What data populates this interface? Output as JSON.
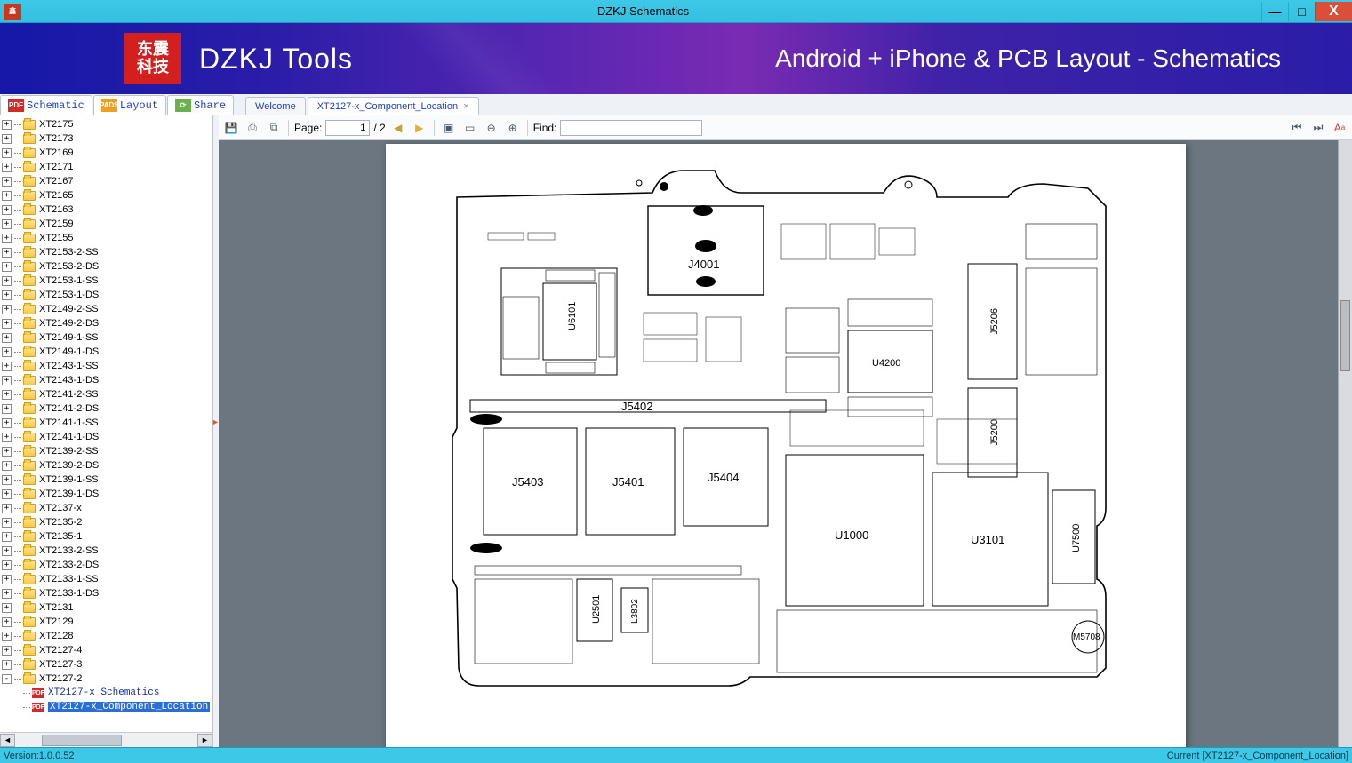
{
  "window": {
    "title": "DZKJ Schematics"
  },
  "banner": {
    "logo_line1": "东震",
    "logo_line2": "科技",
    "tools": "DZKJ Tools",
    "tagline": "Android + iPhone & PCB Layout - Schematics"
  },
  "globalTabs": {
    "schematic": "Schematic",
    "layout": "Layout",
    "share": "Share"
  },
  "docTabs": {
    "welcome": "Welcome",
    "active": "XT2127-x_Component_Location"
  },
  "toolbar": {
    "page_label": "Page:",
    "page_current": "1",
    "page_total": "/ 2",
    "find_label": "Find:",
    "find_value": ""
  },
  "tree": {
    "folders": [
      "XT2175",
      "XT2173",
      "XT2169",
      "XT2171",
      "XT2167",
      "XT2165",
      "XT2163",
      "XT2159",
      "XT2155",
      "XT2153-2-SS",
      "XT2153-2-DS",
      "XT2153-1-SS",
      "XT2153-1-DS",
      "XT2149-2-SS",
      "XT2149-2-DS",
      "XT2149-1-SS",
      "XT2149-1-DS",
      "XT2143-1-SS",
      "XT2143-1-DS",
      "XT2141-2-SS",
      "XT2141-2-DS",
      "XT2141-1-SS",
      "XT2141-1-DS",
      "XT2139-2-SS",
      "XT2139-2-DS",
      "XT2139-1-SS",
      "XT2139-1-DS",
      "XT2137-x",
      "XT2135-2",
      "XT2135-1",
      "XT2133-2-SS",
      "XT2133-2-DS",
      "XT2133-1-SS",
      "XT2133-1-DS",
      "XT2131",
      "XT2129",
      "XT2128",
      "XT2127-4",
      "XT2127-3"
    ],
    "expanded": "XT2127-2",
    "children": [
      "XT2127-x_Schematics",
      "XT2127-x_Component_Location"
    ],
    "selectedChild": 1
  },
  "pcb": {
    "J4001": "J4001",
    "U6101": "U6101",
    "J5402": "J5402",
    "J5403": "J5403",
    "J5401": "J5401",
    "J5404": "J5404",
    "U4200": "U4200",
    "U1000": "U1000",
    "U3101": "U3101",
    "U2501": "U2501",
    "U7500": "U7500",
    "J5206": "J5206",
    "J5200": "J5200",
    "M5708": "M5708",
    "L3802": "L3802"
  },
  "status": {
    "version": "Version:1.0.0.52",
    "current": "Current [XT2127-x_Component_Location]"
  }
}
